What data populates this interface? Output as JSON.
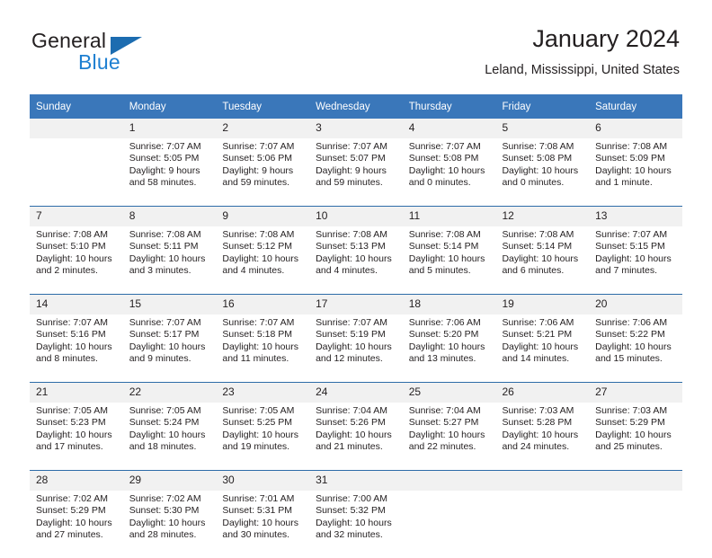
{
  "brand": {
    "name_top": "General",
    "name_bottom": "Blue",
    "accent_color": "#1d7fd1",
    "triangle_color": "#1c6cb0"
  },
  "header": {
    "title": "January 2024",
    "subtitle": "Leland, Mississippi, United States"
  },
  "theme": {
    "header_row_bg": "#3a77ba",
    "daynum_bg": "#f1f1f1",
    "separator": "#2d6ca8",
    "text": "#231f20"
  },
  "weekdays": [
    "Sunday",
    "Monday",
    "Tuesday",
    "Wednesday",
    "Thursday",
    "Friday",
    "Saturday"
  ],
  "weeks": [
    {
      "days": [
        {
          "num": "",
          "sunrise": "",
          "sunset": "",
          "daylight1": "",
          "daylight2": ""
        },
        {
          "num": "1",
          "sunrise": "Sunrise: 7:07 AM",
          "sunset": "Sunset: 5:05 PM",
          "daylight1": "Daylight: 9 hours",
          "daylight2": "and 58 minutes."
        },
        {
          "num": "2",
          "sunrise": "Sunrise: 7:07 AM",
          "sunset": "Sunset: 5:06 PM",
          "daylight1": "Daylight: 9 hours",
          "daylight2": "and 59 minutes."
        },
        {
          "num": "3",
          "sunrise": "Sunrise: 7:07 AM",
          "sunset": "Sunset: 5:07 PM",
          "daylight1": "Daylight: 9 hours",
          "daylight2": "and 59 minutes."
        },
        {
          "num": "4",
          "sunrise": "Sunrise: 7:07 AM",
          "sunset": "Sunset: 5:08 PM",
          "daylight1": "Daylight: 10 hours",
          "daylight2": "and 0 minutes."
        },
        {
          "num": "5",
          "sunrise": "Sunrise: 7:08 AM",
          "sunset": "Sunset: 5:08 PM",
          "daylight1": "Daylight: 10 hours",
          "daylight2": "and 0 minutes."
        },
        {
          "num": "6",
          "sunrise": "Sunrise: 7:08 AM",
          "sunset": "Sunset: 5:09 PM",
          "daylight1": "Daylight: 10 hours",
          "daylight2": "and 1 minute."
        }
      ]
    },
    {
      "days": [
        {
          "num": "7",
          "sunrise": "Sunrise: 7:08 AM",
          "sunset": "Sunset: 5:10 PM",
          "daylight1": "Daylight: 10 hours",
          "daylight2": "and 2 minutes."
        },
        {
          "num": "8",
          "sunrise": "Sunrise: 7:08 AM",
          "sunset": "Sunset: 5:11 PM",
          "daylight1": "Daylight: 10 hours",
          "daylight2": "and 3 minutes."
        },
        {
          "num": "9",
          "sunrise": "Sunrise: 7:08 AM",
          "sunset": "Sunset: 5:12 PM",
          "daylight1": "Daylight: 10 hours",
          "daylight2": "and 4 minutes."
        },
        {
          "num": "10",
          "sunrise": "Sunrise: 7:08 AM",
          "sunset": "Sunset: 5:13 PM",
          "daylight1": "Daylight: 10 hours",
          "daylight2": "and 4 minutes."
        },
        {
          "num": "11",
          "sunrise": "Sunrise: 7:08 AM",
          "sunset": "Sunset: 5:14 PM",
          "daylight1": "Daylight: 10 hours",
          "daylight2": "and 5 minutes."
        },
        {
          "num": "12",
          "sunrise": "Sunrise: 7:08 AM",
          "sunset": "Sunset: 5:14 PM",
          "daylight1": "Daylight: 10 hours",
          "daylight2": "and 6 minutes."
        },
        {
          "num": "13",
          "sunrise": "Sunrise: 7:07 AM",
          "sunset": "Sunset: 5:15 PM",
          "daylight1": "Daylight: 10 hours",
          "daylight2": "and 7 minutes."
        }
      ]
    },
    {
      "days": [
        {
          "num": "14",
          "sunrise": "Sunrise: 7:07 AM",
          "sunset": "Sunset: 5:16 PM",
          "daylight1": "Daylight: 10 hours",
          "daylight2": "and 8 minutes."
        },
        {
          "num": "15",
          "sunrise": "Sunrise: 7:07 AM",
          "sunset": "Sunset: 5:17 PM",
          "daylight1": "Daylight: 10 hours",
          "daylight2": "and 9 minutes."
        },
        {
          "num": "16",
          "sunrise": "Sunrise: 7:07 AM",
          "sunset": "Sunset: 5:18 PM",
          "daylight1": "Daylight: 10 hours",
          "daylight2": "and 11 minutes."
        },
        {
          "num": "17",
          "sunrise": "Sunrise: 7:07 AM",
          "sunset": "Sunset: 5:19 PM",
          "daylight1": "Daylight: 10 hours",
          "daylight2": "and 12 minutes."
        },
        {
          "num": "18",
          "sunrise": "Sunrise: 7:06 AM",
          "sunset": "Sunset: 5:20 PM",
          "daylight1": "Daylight: 10 hours",
          "daylight2": "and 13 minutes."
        },
        {
          "num": "19",
          "sunrise": "Sunrise: 7:06 AM",
          "sunset": "Sunset: 5:21 PM",
          "daylight1": "Daylight: 10 hours",
          "daylight2": "and 14 minutes."
        },
        {
          "num": "20",
          "sunrise": "Sunrise: 7:06 AM",
          "sunset": "Sunset: 5:22 PM",
          "daylight1": "Daylight: 10 hours",
          "daylight2": "and 15 minutes."
        }
      ]
    },
    {
      "days": [
        {
          "num": "21",
          "sunrise": "Sunrise: 7:05 AM",
          "sunset": "Sunset: 5:23 PM",
          "daylight1": "Daylight: 10 hours",
          "daylight2": "and 17 minutes."
        },
        {
          "num": "22",
          "sunrise": "Sunrise: 7:05 AM",
          "sunset": "Sunset: 5:24 PM",
          "daylight1": "Daylight: 10 hours",
          "daylight2": "and 18 minutes."
        },
        {
          "num": "23",
          "sunrise": "Sunrise: 7:05 AM",
          "sunset": "Sunset: 5:25 PM",
          "daylight1": "Daylight: 10 hours",
          "daylight2": "and 19 minutes."
        },
        {
          "num": "24",
          "sunrise": "Sunrise: 7:04 AM",
          "sunset": "Sunset: 5:26 PM",
          "daylight1": "Daylight: 10 hours",
          "daylight2": "and 21 minutes."
        },
        {
          "num": "25",
          "sunrise": "Sunrise: 7:04 AM",
          "sunset": "Sunset: 5:27 PM",
          "daylight1": "Daylight: 10 hours",
          "daylight2": "and 22 minutes."
        },
        {
          "num": "26",
          "sunrise": "Sunrise: 7:03 AM",
          "sunset": "Sunset: 5:28 PM",
          "daylight1": "Daylight: 10 hours",
          "daylight2": "and 24 minutes."
        },
        {
          "num": "27",
          "sunrise": "Sunrise: 7:03 AM",
          "sunset": "Sunset: 5:29 PM",
          "daylight1": "Daylight: 10 hours",
          "daylight2": "and 25 minutes."
        }
      ]
    },
    {
      "days": [
        {
          "num": "28",
          "sunrise": "Sunrise: 7:02 AM",
          "sunset": "Sunset: 5:29 PM",
          "daylight1": "Daylight: 10 hours",
          "daylight2": "and 27 minutes."
        },
        {
          "num": "29",
          "sunrise": "Sunrise: 7:02 AM",
          "sunset": "Sunset: 5:30 PM",
          "daylight1": "Daylight: 10 hours",
          "daylight2": "and 28 minutes."
        },
        {
          "num": "30",
          "sunrise": "Sunrise: 7:01 AM",
          "sunset": "Sunset: 5:31 PM",
          "daylight1": "Daylight: 10 hours",
          "daylight2": "and 30 minutes."
        },
        {
          "num": "31",
          "sunrise": "Sunrise: 7:00 AM",
          "sunset": "Sunset: 5:32 PM",
          "daylight1": "Daylight: 10 hours",
          "daylight2": "and 32 minutes."
        },
        {
          "num": "",
          "sunrise": "",
          "sunset": "",
          "daylight1": "",
          "daylight2": ""
        },
        {
          "num": "",
          "sunrise": "",
          "sunset": "",
          "daylight1": "",
          "daylight2": ""
        },
        {
          "num": "",
          "sunrise": "",
          "sunset": "",
          "daylight1": "",
          "daylight2": ""
        }
      ]
    }
  ]
}
